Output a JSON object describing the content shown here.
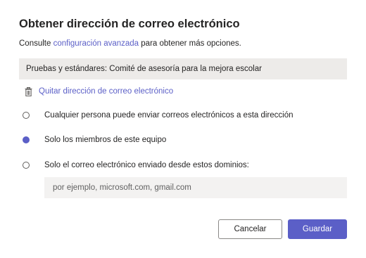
{
  "dialog": {
    "title": "Obtener dirección de correo electrónico",
    "subtitle": {
      "prefix": "Consulte ",
      "link": "configuración avanzada",
      "suffix": " para obtener más opciones."
    },
    "email_address": "Pruebas y estándares: Comité de asesoría para la mejora escolar",
    "remove_link": {
      "icon": "trash-icon",
      "label": "Quitar dirección de correo electrónico"
    },
    "options": [
      {
        "label": "Cualquier persona puede enviar correos electrónicos a esta dirección",
        "selected": false
      },
      {
        "label": "Solo los miembros de este equipo",
        "selected": true
      },
      {
        "label": "Solo el correo electrónico enviado desde estos dominios:",
        "selected": false
      }
    ],
    "domains_input": {
      "value": "",
      "placeholder": "por ejemplo, microsoft.com, gmail.com"
    },
    "buttons": {
      "cancel": "Cancelar",
      "save": "Guardar"
    },
    "colors": {
      "accent": "#5b5fc7",
      "text": "#252424",
      "field_bg": "#edebe9"
    }
  }
}
